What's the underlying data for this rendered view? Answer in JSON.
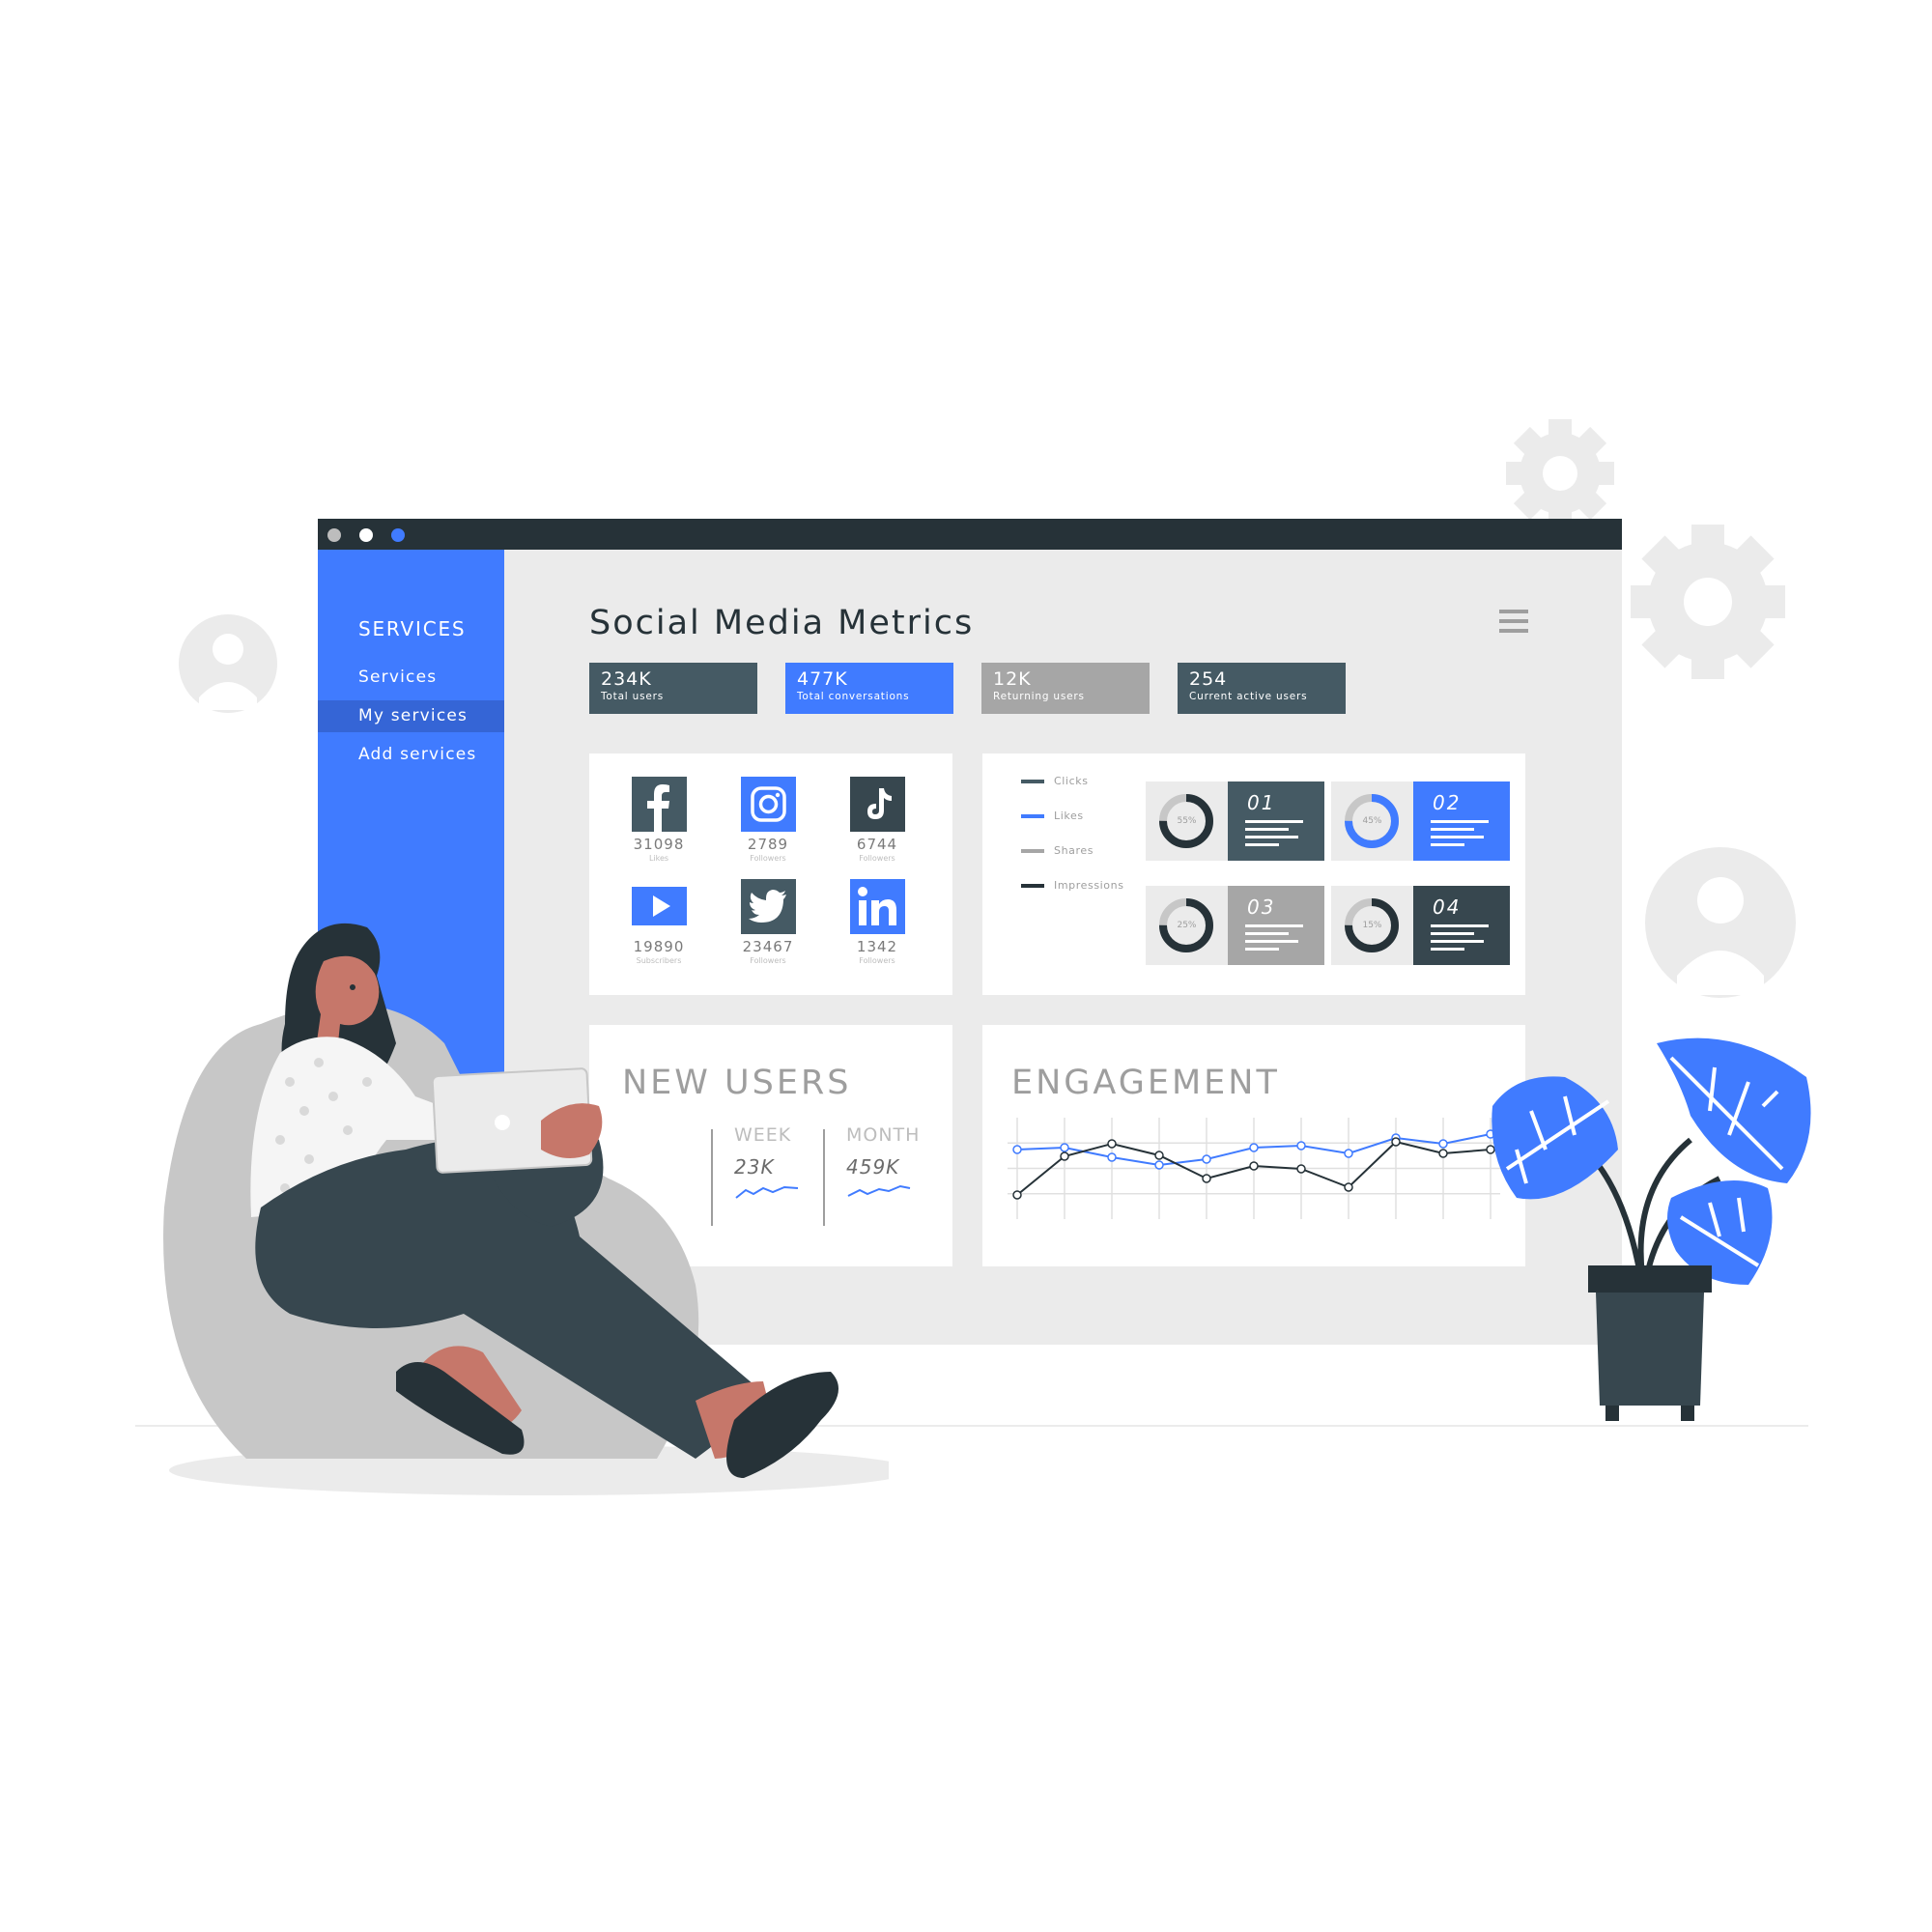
{
  "window": {
    "controls": [
      {
        "name": "window-close-dot",
        "color": "#bdbdbd"
      },
      {
        "name": "window-minimize-dot",
        "color": "#ffffff"
      },
      {
        "name": "window-maximize-dot",
        "color": "#407bff"
      }
    ]
  },
  "colors": {
    "accent": "#407bff",
    "dark": "#263238",
    "slate": "#455a64",
    "gray": "#9e9e9e",
    "panel": "#ebebeb"
  },
  "sidebar": {
    "heading": "SERVICES",
    "items": [
      {
        "label": "Services",
        "active": false
      },
      {
        "label": "My services",
        "active": true
      },
      {
        "label": "Add services",
        "active": false
      }
    ]
  },
  "header": {
    "title": "Social Media Metrics",
    "menu_icon": "hamburger-menu-icon"
  },
  "stats": [
    {
      "value": "234K",
      "label": "Total users",
      "color": "#455a64"
    },
    {
      "value": "477K",
      "label": "Total conversations",
      "color": "#407bff"
    },
    {
      "value": "12K",
      "label": "Returning users",
      "color": "#a6a6a6"
    },
    {
      "value": "254",
      "label": "Current active users",
      "color": "#455a64"
    }
  ],
  "social": [
    {
      "network": "Facebook",
      "icon": "facebook-icon",
      "count": "31098",
      "unit": "Likes"
    },
    {
      "network": "Instagram",
      "icon": "instagram-icon",
      "count": "2789",
      "unit": "Followers"
    },
    {
      "network": "TikTok",
      "icon": "tiktok-icon",
      "count": "6744",
      "unit": "Followers"
    },
    {
      "network": "YouTube",
      "icon": "youtube-icon",
      "count": "19890",
      "unit": "Subscribers"
    },
    {
      "network": "Twitter",
      "icon": "twitter-icon",
      "count": "23467",
      "unit": "Followers"
    },
    {
      "network": "LinkedIn",
      "icon": "linkedin-icon",
      "count": "1342",
      "unit": "Followers"
    }
  ],
  "legend": [
    {
      "label": "Clicks",
      "color": "#455a64"
    },
    {
      "label": "Likes",
      "color": "#407bff"
    },
    {
      "label": "Shares",
      "color": "#a6a6a6"
    },
    {
      "label": "Impressions",
      "color": "#263238"
    }
  ],
  "breakdown": [
    {
      "number": "01",
      "percent": "55%",
      "fraction": 0.55,
      "color": "#455a64",
      "ring": "#263238"
    },
    {
      "number": "02",
      "percent": "45%",
      "fraction": 0.45,
      "color": "#407bff",
      "ring": "#407bff"
    },
    {
      "number": "03",
      "percent": "25%",
      "fraction": 0.25,
      "color": "#a6a6a6",
      "ring": "#263238"
    },
    {
      "number": "04",
      "percent": "15%",
      "fraction": 0.15,
      "color": "#37474f",
      "ring": "#263238"
    }
  ],
  "new_users": {
    "heading": "NEW USERS",
    "columns": [
      {
        "label": "WEEK",
        "value": "23K"
      },
      {
        "label": "MONTH",
        "value": "459K"
      }
    ]
  },
  "engagement": {
    "heading": "ENGAGEMENT"
  },
  "chart_data": {
    "type": "line",
    "title": "ENGAGEMENT",
    "x": [
      1,
      2,
      3,
      4,
      5,
      6,
      7,
      8,
      9,
      10,
      11
    ],
    "ylim": [
      0,
      10
    ],
    "grid": true,
    "series": [
      {
        "color": "#407bff",
        "values": [
          7.2,
          7.4,
          6.4,
          5.6,
          6.2,
          7.4,
          7.6,
          6.8,
          8.4,
          7.8,
          8.8
        ]
      },
      {
        "color": "#263238",
        "values": [
          2.5,
          6.5,
          7.8,
          6.6,
          4.2,
          5.5,
          5.2,
          3.3,
          8.0,
          6.8,
          7.2
        ]
      }
    ]
  },
  "decor": {
    "illustration": "woman-on-beanbag-with-tablet",
    "plant": "potted-monstera-plant",
    "gears": "gear-icon",
    "avatars": "user-avatar-icon"
  }
}
